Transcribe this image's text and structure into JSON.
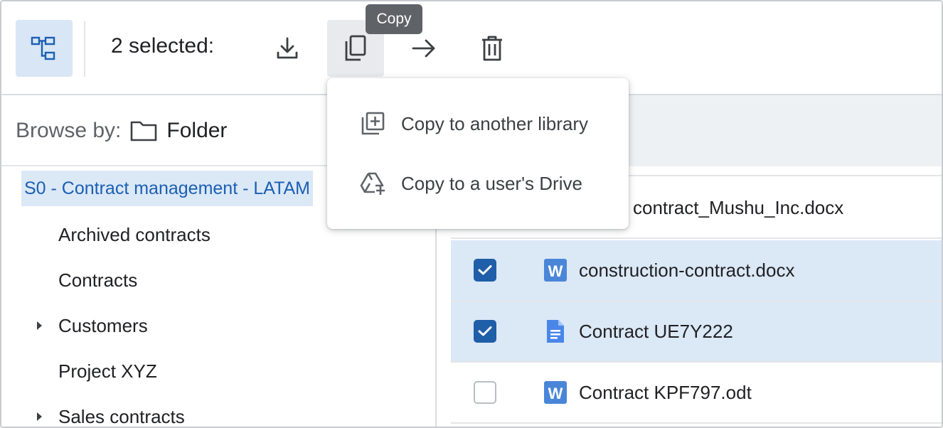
{
  "toolbar": {
    "selected_text": "2 selected:",
    "tooltip": "Copy",
    "icons": [
      "tree-view-icon",
      "download-icon",
      "copy-icon",
      "move-arrow-icon",
      "trash-icon"
    ]
  },
  "copy_menu": {
    "items": [
      {
        "label": "Copy to another library",
        "icon": "library-add-icon"
      },
      {
        "label": "Copy to a user's Drive",
        "icon": "drive-add-icon"
      }
    ]
  },
  "browse": {
    "label": "Browse by:",
    "mode": "Folder"
  },
  "tree": {
    "root": "S0 - Contract management - LATAM",
    "items": [
      {
        "label": "Archived contracts",
        "expandable": false
      },
      {
        "label": "Contracts",
        "expandable": false
      },
      {
        "label": "Customers",
        "expandable": true
      },
      {
        "label": "Project XYZ",
        "expandable": false
      },
      {
        "label": "Sales contracts",
        "expandable": true
      }
    ]
  },
  "files": [
    {
      "name": "contract_Mushu_Inc.docx",
      "type": "word",
      "checked": false
    },
    {
      "name": "construction-contract.docx",
      "type": "word",
      "checked": true
    },
    {
      "name": "Contract UE7Y222",
      "type": "gdoc",
      "checked": true
    },
    {
      "name": "Contract KPF797.odt",
      "type": "word",
      "checked": false
    }
  ],
  "colors": {
    "accent": "#1f5ea8",
    "selection_bg": "#dbe8f6",
    "tooltip_bg": "#5f6368"
  }
}
